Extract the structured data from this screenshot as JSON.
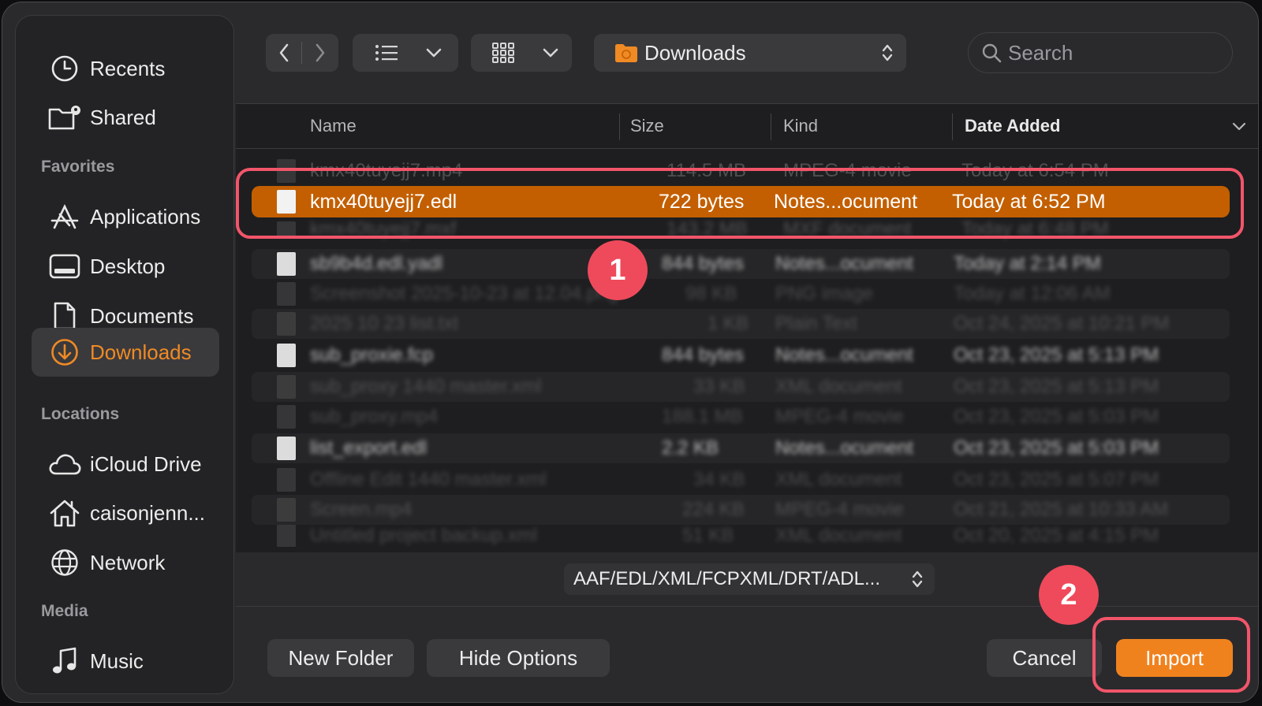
{
  "sidebar": {
    "top": [
      {
        "label": "Recents",
        "icon": "clock-icon"
      },
      {
        "label": "Shared",
        "icon": "shared-folder-icon"
      }
    ],
    "favorites_header": "Favorites",
    "favorites": [
      {
        "label": "Applications",
        "icon": "applications-icon"
      },
      {
        "label": "Desktop",
        "icon": "desktop-icon"
      },
      {
        "label": "Documents",
        "icon": "document-icon"
      },
      {
        "label": "Downloads",
        "icon": "download-icon",
        "active": true
      }
    ],
    "locations_header": "Locations",
    "locations": [
      {
        "label": "iCloud Drive",
        "icon": "cloud-icon"
      },
      {
        "label": "caisonjenn...",
        "icon": "home-icon"
      },
      {
        "label": "Network",
        "icon": "globe-icon"
      }
    ],
    "media_header": "Media",
    "media": [
      {
        "label": "Music",
        "icon": "music-note-icon"
      }
    ]
  },
  "toolbar": {
    "location": "Downloads",
    "search_placeholder": "Search"
  },
  "columns": {
    "name": "Name",
    "size": "Size",
    "kind": "Kind",
    "date": "Date Added"
  },
  "files": [
    {
      "name": "kmx40tuyejj7.mp4",
      "size": "114.5 MB",
      "kind": "MPEG-4 movie",
      "date": "Today at 6:54 PM"
    },
    {
      "name": "kmx40tuyejj7.edl",
      "size": "722 bytes",
      "kind": "Notes...ocument",
      "date": "Today at 6:52 PM"
    },
    {
      "name": "kmx40tuyejj7.mxf",
      "size": "143.2 MB",
      "kind": "MXF document",
      "date": "Today at 6:48 PM"
    },
    {
      "name": "sb9b4d.edl.yadl",
      "size": "844 bytes",
      "kind": "Notes...ocument",
      "date": "Today at 2:14 PM"
    },
    {
      "name": "Screenshot 2025-10-23 at 12.04.png",
      "size": "98 KB",
      "kind": "PNG image",
      "date": "Today at 12:06 AM"
    },
    {
      "name": "2025 10 23 list.txt",
      "size": "1 KB",
      "kind": "Plain Text",
      "date": "Oct 24, 2025 at 10:21 PM"
    },
    {
      "name": "sub_proxie.fcp",
      "size": "844 bytes",
      "kind": "Notes...ocument",
      "date": "Oct 23, 2025 at 5:13 PM"
    },
    {
      "name": "sub_proxy 1440 master.xml",
      "size": "33 KB",
      "kind": "XML document",
      "date": "Oct 23, 2025 at 5:13 PM"
    },
    {
      "name": "sub_proxy.mp4",
      "size": "188.1 MB",
      "kind": "MPEG-4 movie",
      "date": "Oct 23, 2025 at 5:03 PM"
    },
    {
      "name": "list_export.edl",
      "size": "2.2 KB",
      "kind": "Notes...ocument",
      "date": "Oct 23, 2025 at 5:03 PM"
    },
    {
      "name": "Offline Edit 1440 master.xml",
      "size": "34 KB",
      "kind": "XML document",
      "date": "Oct 23, 2025 at 5:07 PM"
    },
    {
      "name": "Screen.mp4",
      "size": "224 KB",
      "kind": "MPEG-4 movie",
      "date": "Oct 21, 2025 at 10:33 AM"
    },
    {
      "name": "Untitled project backup.xml",
      "size": "51 KB",
      "kind": "XML document",
      "date": "Oct 20, 2025 at 4:15 PM"
    }
  ],
  "format_filter": "AAF/EDL/XML/FCPXML/DRT/ADL...",
  "buttons": {
    "new_folder": "New Folder",
    "hide_options": "Hide Options",
    "cancel": "Cancel",
    "import": "Import"
  },
  "annotations": {
    "step1": "1",
    "step2": "2"
  },
  "colors": {
    "accent": "#f0821e",
    "selection": "#c35f00",
    "annotation": "#ef4a5b"
  }
}
